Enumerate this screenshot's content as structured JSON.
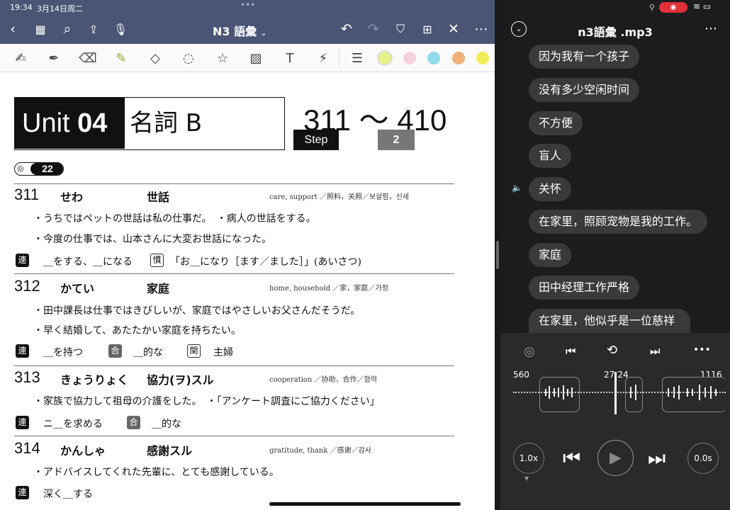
{
  "status": {
    "time": "19:34",
    "date": "3月14日周二"
  },
  "left": {
    "title": "N3 語彙",
    "title_caret": "⌄"
  },
  "colors": {
    "topbar": "#4a5575",
    "swatches": [
      "#e8f08a",
      "#f6d3dc",
      "#8fdcec",
      "#f0b07a",
      "#f3ec5a"
    ]
  },
  "doc": {
    "unit": "Unit",
    "unit_num": "04",
    "unit_title": "名詞 B",
    "range": "311 〜 410",
    "step": "Step",
    "step_num": "2",
    "audio_track": "22",
    "entries": [
      {
        "num": "311",
        "kana": "せわ",
        "kanji": "世話",
        "gloss": "care, support ／照料，关照／보살핌，신세",
        "examples": [
          "・うちではペットの世話は私の仕事だ。　・病人の世話をする。",
          "・今度の仕事では、山本さんに大変お世話になった。"
        ],
        "collocations": [
          {
            "tag": "連",
            "text": "＿をする、＿になる"
          },
          {
            "tag": "慣",
            "text": "「お＿になり［ます／ました］」(あいさつ)"
          }
        ]
      },
      {
        "num": "312",
        "kana": "かてい",
        "kanji": "家庭",
        "gloss": "home, household ／家，家庭／가정",
        "examples": [
          "・田中課長は仕事ではきびしいが、家庭ではやさしいお父さんだそうだ。",
          "・早く結婚して、あたたかい家庭を持ちたい。"
        ],
        "collocations": [
          {
            "tag": "連",
            "text": "＿を持つ"
          },
          {
            "tag": "合",
            "text": "＿的な"
          },
          {
            "tag": "関",
            "text": "主婦"
          }
        ]
      },
      {
        "num": "313",
        "kana": "きょうりょく",
        "kanji": "協力(ヲ)スル",
        "gloss": "cooperation ／协助，合作／협력",
        "examples": [
          "・家族で協力して祖母の介護をした。　・「アンケート調査にご協力ください」"
        ],
        "collocations": [
          {
            "tag": "連",
            "text": "ニ＿を求める"
          },
          {
            "tag": "合",
            "text": "＿的な"
          }
        ]
      },
      {
        "num": "314",
        "kana": "かんしゃ",
        "kanji": "感謝スル",
        "gloss": "gratitude, thank ／感谢／감사",
        "examples": [
          "・アドバイスしてくれた先輩に、とても感謝している。"
        ],
        "collocations": [
          {
            "tag": "連",
            "text": "深く＿する"
          }
        ]
      }
    ]
  },
  "right": {
    "title": "n3語彙 .mp3",
    "messages": [
      "因为我有一个孩子",
      "没有多少空闲时间",
      "不方便",
      "盲人",
      "关怀",
      "在家里，照顾宠物是我的工作。",
      "家庭",
      "田中经理工作严格",
      "在家里，他似乎是一位慈祥的父亲"
    ],
    "player": {
      "left_marker": "560",
      "current_time": "27:24",
      "right_marker": "1116",
      "speed": "1.0x",
      "offset": "0.0s"
    }
  }
}
